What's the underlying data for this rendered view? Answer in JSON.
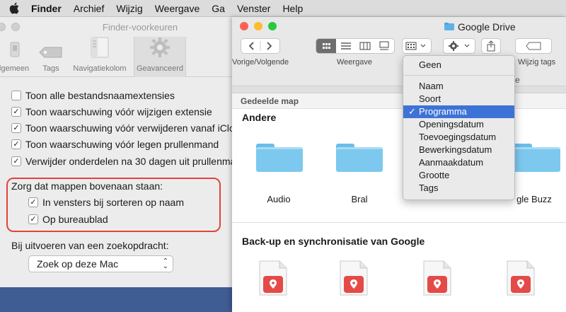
{
  "menubar": {
    "items": [
      "Finder",
      "Archief",
      "Wijzig",
      "Weergave",
      "Ga",
      "Venster",
      "Help"
    ]
  },
  "prefs": {
    "title": "Finder-voorkeuren",
    "tabs": [
      "lgemeen",
      "Tags",
      "Navigatiekolom",
      "Geavanceerd"
    ],
    "options": [
      {
        "label": "Toon alle bestandsnaamextensies",
        "checked": false
      },
      {
        "label": "Toon waarschuwing vóór wijzigen extensie",
        "checked": true
      },
      {
        "label": "Toon waarschuwing vóór verwijderen vanaf iClo",
        "checked": true
      },
      {
        "label": "Toon waarschuwing vóór legen prullenmand",
        "checked": true
      },
      {
        "label": "Verwijder onderdelen na 30 dagen uit prullenma",
        "checked": true
      }
    ],
    "folders_heading": "Zorg dat mappen bovenaan staan:",
    "folders_options": [
      {
        "label": "In vensters bij sorteren op naam",
        "checked": true
      },
      {
        "label": "Op bureaublad",
        "checked": true
      }
    ],
    "search_heading": "Bij uitvoeren van een zoekopdracht:",
    "search_value": "Zoek op deze Mac"
  },
  "finder": {
    "title": "Google Drive",
    "toolbar_labels": {
      "nav": "Vorige/Volgende",
      "view": "Weergave",
      "tags": "Wijzig tags"
    },
    "shared_label": "Gedeelde map",
    "section1": "Andere",
    "folders": [
      "Audio",
      "Bral",
      "gle Buzz"
    ],
    "section2": "Back-up en synchronisatie van Google"
  },
  "sort_menu": {
    "items": [
      "Geen",
      "Naam",
      "Soort",
      "Programma",
      "Openingsdatum",
      "Toevoegingsdatum",
      "Bewerkingsdatum",
      "Aanmaakdatum",
      "Grootte",
      "Tags"
    ],
    "selected": "Programma",
    "checkmark": "✓",
    "partial_header": "e"
  },
  "colors": {
    "accent": "#3d73d6",
    "highlight_box": "#e0443c",
    "folder": "#7dc8ef",
    "desktop": "#3f5c93"
  }
}
